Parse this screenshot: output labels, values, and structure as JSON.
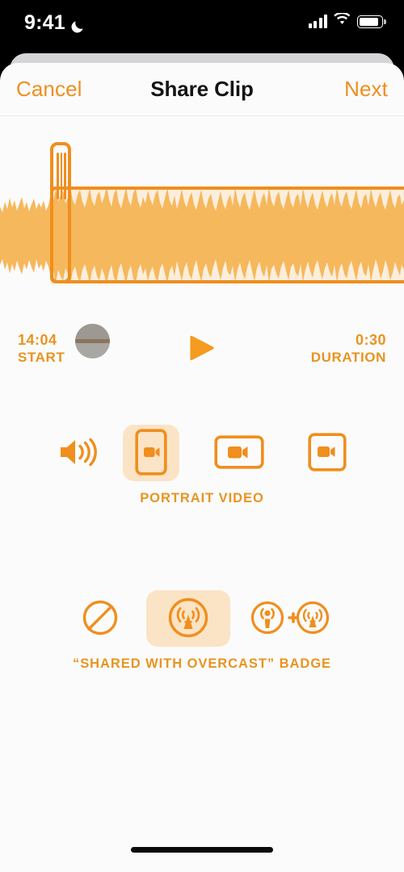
{
  "status_bar": {
    "time": "9:41",
    "dnd_icon": "crescent-moon-icon",
    "signal_icon": "cellular-signal-icon",
    "wifi_icon": "wifi-icon",
    "battery_icon": "battery-icon"
  },
  "navbar": {
    "cancel_label": "Cancel",
    "title": "Share Clip",
    "next_label": "Next"
  },
  "editor": {
    "start_value": "14:04",
    "start_label": "START",
    "duration_value": "0:30",
    "duration_label": "DURATION",
    "play_icon": "play-icon",
    "trim_handle_icon": "trim-handle-icon",
    "scrubber_icon": "scrubber-knob-icon"
  },
  "format_section": {
    "caption": "PORTRAIT VIDEO",
    "options": [
      {
        "id": "audio-only",
        "icon": "speaker-waves-icon",
        "label": "Audio Only",
        "selected": false
      },
      {
        "id": "portrait-video",
        "icon": "portrait-video-icon",
        "label": "Portrait Video",
        "selected": true
      },
      {
        "id": "landscape-video",
        "icon": "landscape-video-icon",
        "label": "Landscape Video",
        "selected": false
      },
      {
        "id": "square-video",
        "icon": "square-video-icon",
        "label": "Square Video",
        "selected": false
      }
    ]
  },
  "badge_section": {
    "caption": "“SHARED WITH OVERCAST” BADGE",
    "options": [
      {
        "id": "no-badge",
        "icon": "circle-slash-icon",
        "label": "No Badge",
        "selected": false
      },
      {
        "id": "overcast-badge",
        "icon": "overcast-logo-icon",
        "label": "Overcast Badge",
        "selected": true
      },
      {
        "id": "podcast-plus-overcast",
        "icon": "podcast-plus-overcast-icon",
        "label": "Podcast + Overcast",
        "selected": false
      }
    ]
  },
  "colors": {
    "accent": "#F08E1E",
    "accent_text": "#E89420",
    "selected_tile": "#FBE4C5",
    "waveform": "#F6B85C",
    "waveform_bg_selected": "#FBEEDC",
    "sheet_bg": "#FBFBFB",
    "title": "#141416"
  },
  "home_indicator": "home-indicator"
}
